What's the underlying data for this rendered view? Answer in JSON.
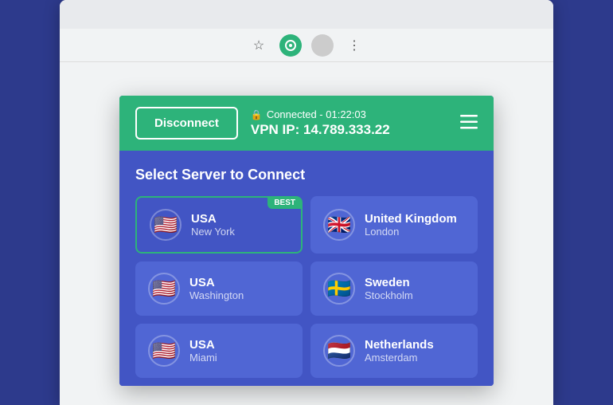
{
  "browser": {
    "toolbar": {
      "star_icon": "☆",
      "vpn_icon": "●",
      "more_icon": "⋮"
    }
  },
  "vpn": {
    "header": {
      "disconnect_label": "Disconnect",
      "connected_text": "Connected - 01:22:03",
      "vpn_ip_label": "VPN IP: 14.789.333.22"
    },
    "server_list": {
      "title": "Select Server to Connect",
      "servers": [
        {
          "id": "usa-newyork",
          "country": "USA",
          "city": "New York",
          "flag": "🇺🇸",
          "active": true,
          "best": true
        },
        {
          "id": "uk-london",
          "country": "United Kingdom",
          "city": "London",
          "flag": "🇬🇧",
          "active": false,
          "best": false
        },
        {
          "id": "usa-washington",
          "country": "USA",
          "city": "Washington",
          "flag": "🇺🇸",
          "active": false,
          "best": false
        },
        {
          "id": "sweden-stockholm",
          "country": "Sweden",
          "city": "Stockholm",
          "flag": "🇸🇪",
          "active": false,
          "best": false
        },
        {
          "id": "usa-miami",
          "country": "USA",
          "city": "Miami",
          "flag": "🇺🇸",
          "active": false,
          "best": false
        },
        {
          "id": "netherlands-amsterdam",
          "country": "Netherlands",
          "city": "Amsterdam",
          "flag": "🇳🇱",
          "active": false,
          "best": false
        }
      ]
    }
  },
  "badges": {
    "best_label": "BEST"
  }
}
